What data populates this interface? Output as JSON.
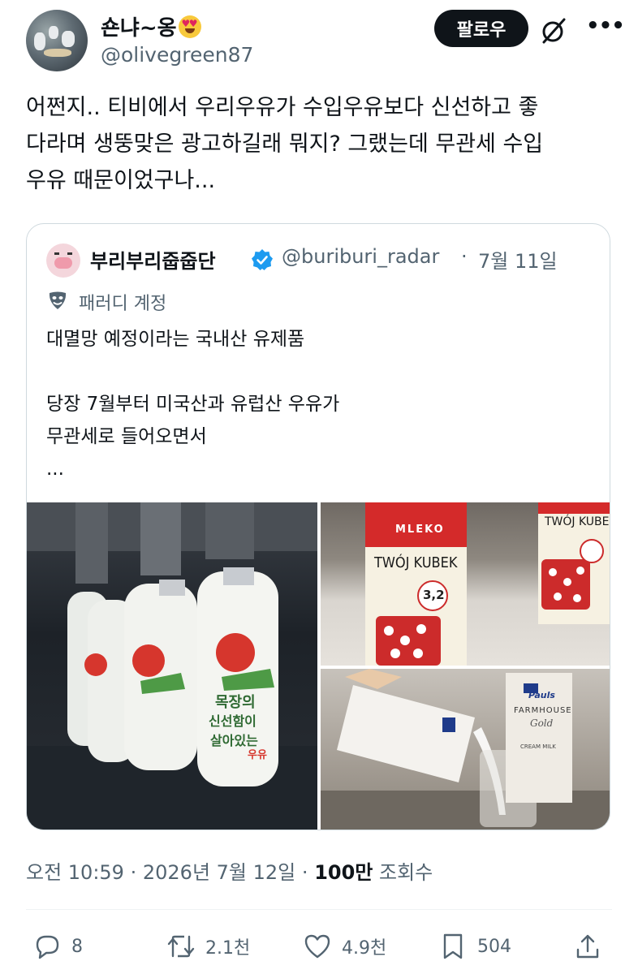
{
  "author": {
    "display_name": "숀냐~옹",
    "handle": "@olivegreen87",
    "emoji": "smiling-face-with-heart-eyes"
  },
  "header": {
    "follow_label": "팔로우",
    "grok_icon": "grok-slash-icon",
    "more_icon": "more-dots-icon"
  },
  "tweet": {
    "lines": [
      "어쩐지.. 티비에서 우리우유가 수입우유보다 신선하고 좋",
      "다라며 생뚱맞은 광고하길래 뭐지? 그랬는데 무관세 수입",
      "우유 때문이었구나..."
    ]
  },
  "quote": {
    "display_name": "부리부리줍줍단",
    "handle": "@buriburi_radar",
    "separator": "·",
    "date": "7월 11일",
    "parody_label": "패러디 계정",
    "lines": [
      "대멸망 예정이라는 국내산 유제품",
      "",
      "당장 7월부터 미국산과 유럽산 우유가",
      "무관세로 들어오면서",
      "..."
    ],
    "media": {
      "left": {
        "bottle_labels": [
          "목장의",
          "신선함이",
          "살아있는",
          "우유"
        ]
      },
      "top_right": {
        "carton_brand": "MLEKO",
        "carton_title": "TWÓJ KUBEK",
        "carton_title_b": "TWÓJ KUBEK",
        "fat": "3,2"
      },
      "bottom_right": {
        "brand": "Pauls",
        "product": "FARMHOUSE",
        "product_sub": "Gold",
        "sub_label": "CREAM MILK"
      }
    }
  },
  "meta": {
    "time": "오전 10:59",
    "dot1": "·",
    "date": "2026년 7월 12일",
    "dot2": "·",
    "views": "100만",
    "views_label": "조회수"
  },
  "actions": {
    "replies": "8",
    "reposts": "2.1천",
    "likes": "4.9천",
    "bookmarks": "504"
  },
  "colors": {
    "text": "#0f1419",
    "secondary": "#536471",
    "border": "#cfd9de",
    "verified": "#1d9bf0"
  }
}
